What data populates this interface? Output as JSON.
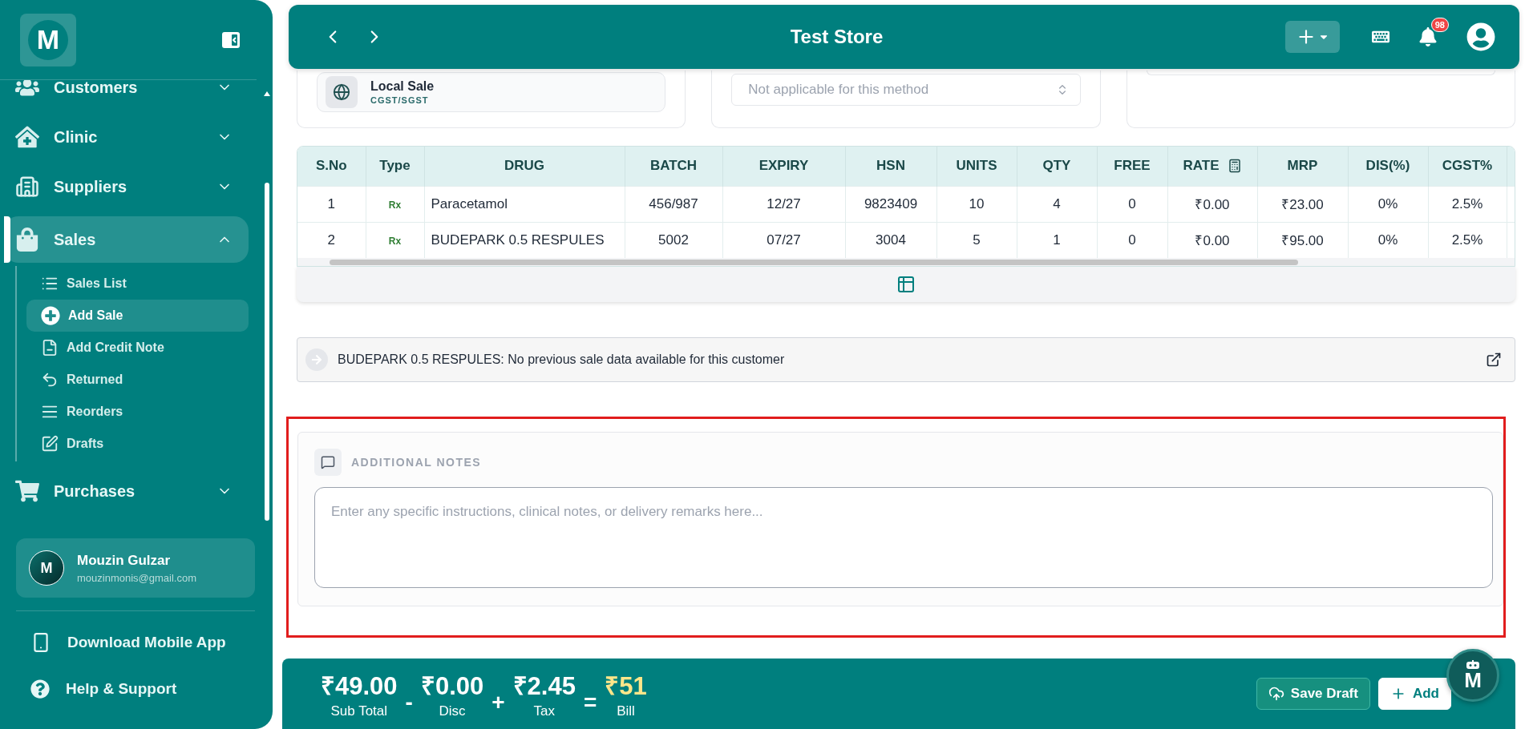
{
  "sidebar": {
    "logo": "M",
    "items": [
      {
        "label": "Customers",
        "expanded": false,
        "selected": false
      },
      {
        "label": "Clinic",
        "expanded": false,
        "selected": false
      },
      {
        "label": "Suppliers",
        "expanded": false,
        "selected": false
      },
      {
        "label": "Sales",
        "expanded": true,
        "selected": true,
        "children": [
          {
            "label": "Sales List",
            "selected": false
          },
          {
            "label": "Add Sale",
            "selected": true
          },
          {
            "label": "Add Credit Note",
            "selected": false
          },
          {
            "label": "Returned",
            "selected": false
          },
          {
            "label": "Reorders",
            "selected": false
          },
          {
            "label": "Drafts",
            "selected": false
          }
        ]
      },
      {
        "label": "Purchases",
        "expanded": false,
        "selected": false
      }
    ],
    "user": {
      "initial": "M",
      "name": "Mouzin Gulzar",
      "email": "mouzinmonis@gmail.com"
    },
    "links": [
      {
        "label": "Download Mobile App"
      },
      {
        "label": "Help & Support"
      }
    ]
  },
  "header": {
    "title": "Test Store",
    "notifications": "98"
  },
  "order_settings": {
    "sale_type": {
      "title": "Local Sale",
      "subtitle": "CGST/SGST"
    },
    "method_select": {
      "value": "Not applicable for this method",
      "disabled": true
    }
  },
  "table": {
    "columns": [
      {
        "label": "S.No",
        "kind": "plain"
      },
      {
        "label": "Type",
        "kind": "tag"
      },
      {
        "label": "DRUG",
        "kind": "name"
      },
      {
        "label": "BATCH",
        "kind": "plain"
      },
      {
        "label": "EXPIRY",
        "kind": "plain"
      },
      {
        "label": "HSN",
        "kind": "plain"
      },
      {
        "label": "UNITS",
        "kind": "plain"
      },
      {
        "label": "QTY",
        "kind": "plain"
      },
      {
        "label": "FREE",
        "kind": "plain"
      },
      {
        "label": "RATE",
        "kind": "rate"
      },
      {
        "label": "MRP",
        "kind": "plain"
      },
      {
        "label": "DIS(%)",
        "kind": "plain"
      },
      {
        "label": "CGST%",
        "kind": "plain"
      }
    ],
    "rows": [
      {
        "cells": [
          "1",
          "Rx",
          "Paracetamol",
          "456/987",
          "12/27",
          "9823409",
          "10",
          "4",
          "0",
          "₹0.00",
          "₹23.00",
          "0%",
          "2.5%"
        ]
      },
      {
        "cells": [
          "2",
          "Rx",
          "BUDEPARK 0.5 RESPULES",
          "5002",
          "07/27",
          "3004",
          "5",
          "1",
          "0",
          "₹0.00",
          "₹95.00",
          "0%",
          "2.5%"
        ]
      }
    ]
  },
  "last_sale_info": {
    "text": "BUDEPARK 0.5 RESPULES: No previous sale data available for this customer"
  },
  "notes": {
    "title": "ADDITIONAL NOTES",
    "placeholder": "Enter any specific instructions, clinical notes, or delivery remarks here...",
    "highlighted": true
  },
  "summary": {
    "terms": [
      {
        "kind": "amount",
        "value": "₹49.00",
        "label": "Sub Total"
      },
      {
        "kind": "operator",
        "value": "-"
      },
      {
        "kind": "amount",
        "value": "₹0.00",
        "label": "Disc"
      },
      {
        "kind": "operator",
        "value": "+"
      },
      {
        "kind": "amount",
        "value": "₹2.45",
        "label": "Tax"
      },
      {
        "kind": "operator",
        "value": "="
      },
      {
        "kind": "total",
        "value": "₹51",
        "label": "Bill"
      }
    ],
    "buttons": [
      {
        "label": "Save Draft",
        "kind": "outline"
      },
      {
        "label": "Add",
        "kind": "solid"
      }
    ]
  },
  "assistant": {
    "logo": "M"
  }
}
